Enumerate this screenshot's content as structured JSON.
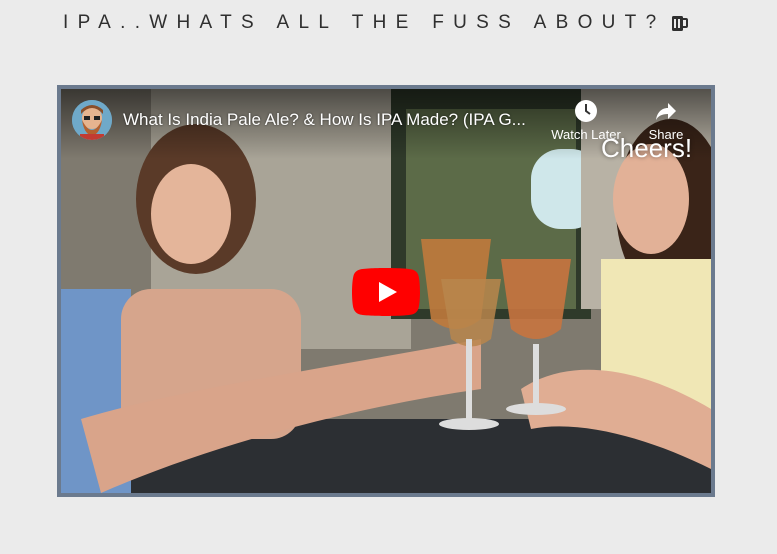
{
  "page": {
    "heading": "IPA..WHATS ALL THE FUSS ABOUT?",
    "heading_icon": "beer-mug-icon"
  },
  "video": {
    "title": "What Is India Pale Ale? & How Is IPA Made? (IPA G...",
    "watch_later_label": "Watch Later",
    "share_label": "Share",
    "overlay_caption": "Cheers!",
    "channel_avatar": "bearded-man-avatar",
    "play_icon": "youtube-play-icon",
    "watch_later_icon": "clock-icon",
    "share_icon": "share-arrow-icon",
    "colors": {
      "play_button": "#ff0000",
      "frame": "#6b7a8e",
      "background": "#ebebeb"
    }
  }
}
